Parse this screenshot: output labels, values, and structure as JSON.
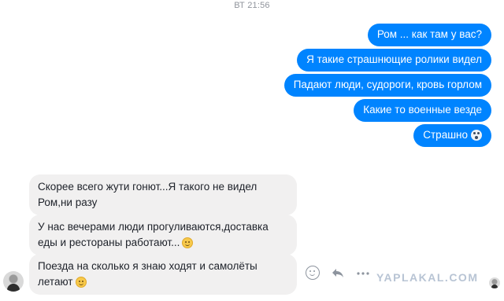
{
  "timestamp": "ВТ 21:56",
  "outgoing": [
    {
      "text": "Ром ... как там у вас?",
      "emoji": ""
    },
    {
      "text": "Я такие страшнющие ролики видел",
      "emoji": ""
    },
    {
      "text": "Падают люди, судороги, кровь горлом",
      "emoji": ""
    },
    {
      "text": "Какие то военные везде",
      "emoji": ""
    },
    {
      "text": "Страшно",
      "emoji": "face-screaming-icon"
    }
  ],
  "incoming": [
    {
      "lines": [
        "Скорее всего жути гонют...Я такого не видел",
        "Ром,ни разу"
      ],
      "emoji": ""
    },
    {
      "lines": [
        "У нас вечерами люди прогуливаются,доставка",
        "еды и рестораны работают..."
      ],
      "emoji": "slight-smile-icon"
    },
    {
      "lines": [
        "Поезда на сколько я знаю ходят и самолёты",
        "летают"
      ],
      "emoji": "slight-smile-icon"
    }
  ],
  "actions": [
    "react-icon",
    "reply-icon",
    "more-icon"
  ],
  "watermark": "YAPLAKAL.COM",
  "colors": {
    "outgoing_bubble": "#0084ff",
    "incoming_bubble": "#f1f0f0",
    "timestamp": "#90949c",
    "watermark": "#b8c4d4"
  }
}
